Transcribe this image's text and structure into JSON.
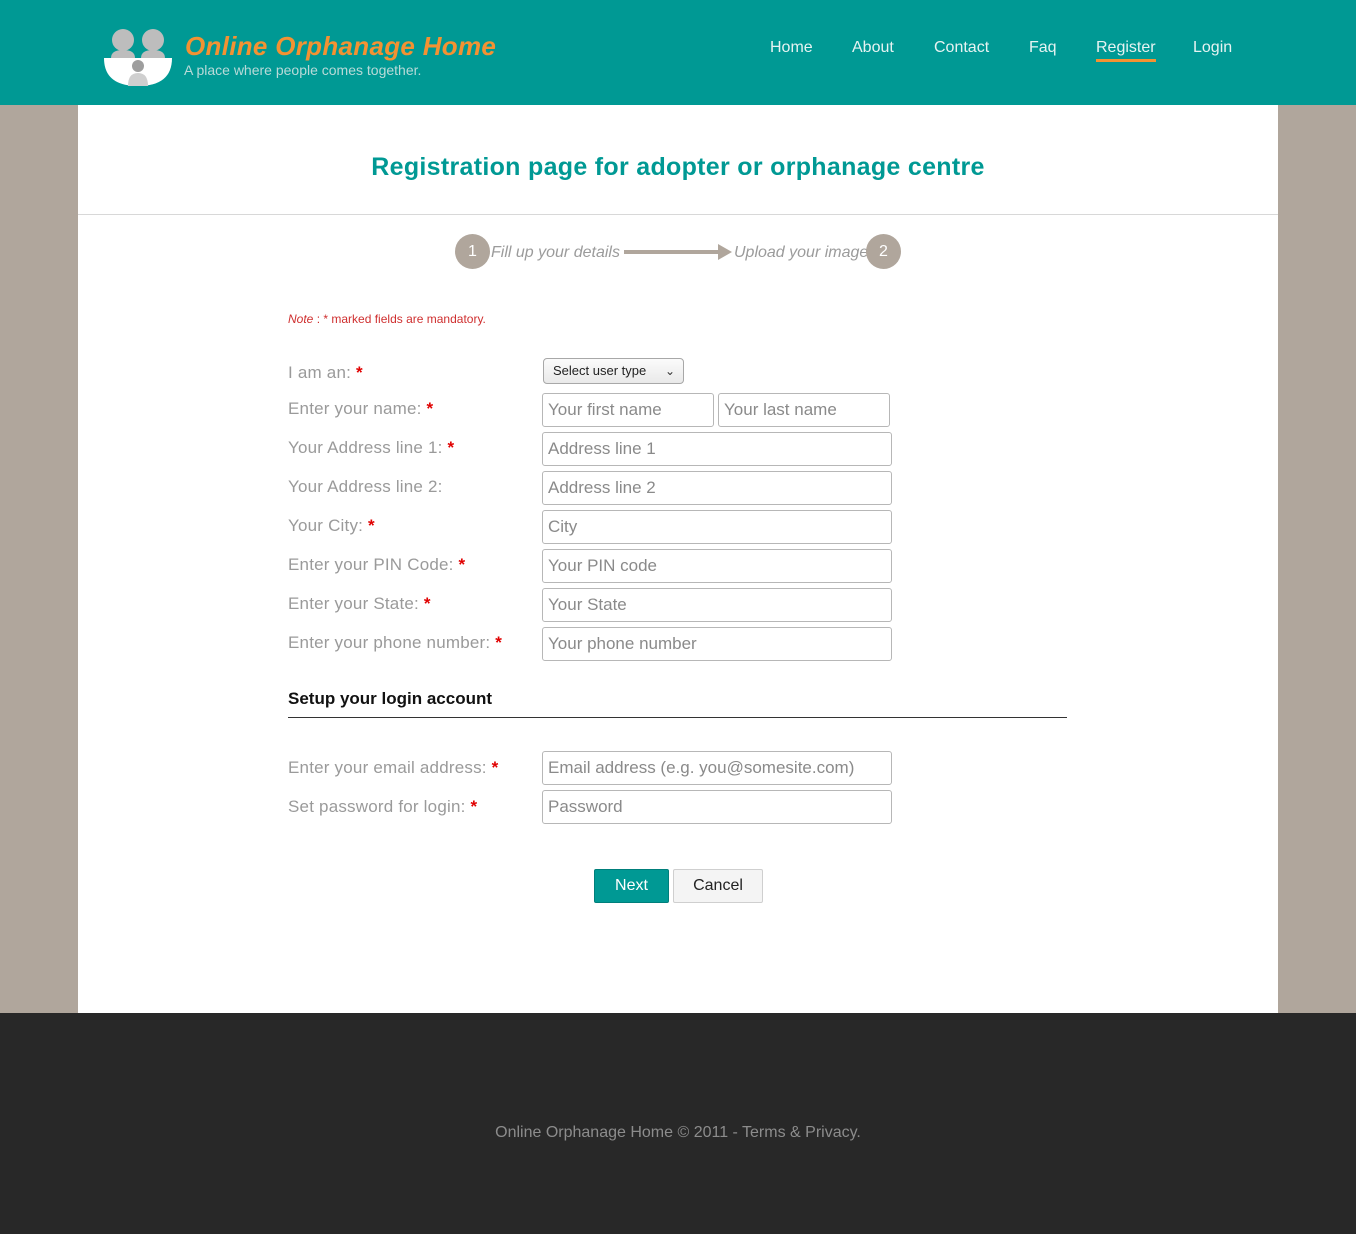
{
  "header": {
    "site_title": "Online Orphanage Home",
    "tagline": "A place where people comes together.",
    "nav": [
      {
        "label": "Home"
      },
      {
        "label": "About"
      },
      {
        "label": "Contact"
      },
      {
        "label": "Faq"
      },
      {
        "label": "Register",
        "active": true
      },
      {
        "label": "Login"
      }
    ]
  },
  "main": {
    "title": "Registration page for adopter or orphanage centre",
    "steps": [
      {
        "number": "1",
        "label": "Fill up your details"
      },
      {
        "number": "2",
        "label": "Upload your image"
      }
    ],
    "note_prefix": "Note",
    "note_text": ": * marked fields are mandatory.",
    "form": {
      "user_type": {
        "label": "I am an:",
        "selected": "Select user type"
      },
      "name": {
        "label": "Enter your name:",
        "first_placeholder": "Your first name",
        "last_placeholder": "Your last name"
      },
      "address1": {
        "label": "Your Address line 1:",
        "placeholder": "Address line 1"
      },
      "address2": {
        "label": "Your Address line 2:",
        "placeholder": "Address line 2"
      },
      "city": {
        "label": "Your City:",
        "placeholder": "City"
      },
      "pin": {
        "label": "Enter your PIN Code:",
        "placeholder": "Your PIN code"
      },
      "state": {
        "label": "Enter your State:",
        "placeholder": "Your State"
      },
      "phone": {
        "label": "Enter your phone number:",
        "placeholder": "Your phone number"
      },
      "login_section_title": "Setup your login account",
      "email": {
        "label": "Enter your email address:",
        "placeholder": "Email address (e.g. you@somesite.com)"
      },
      "password": {
        "label": "Set password for login:",
        "placeholder": "Password"
      },
      "required_mark": "*"
    },
    "buttons": {
      "next": "Next",
      "cancel": "Cancel"
    }
  },
  "footer": {
    "text": "Online Orphanage Home © 2011 - Terms & Privacy."
  },
  "colors": {
    "brand_teal": "#009994",
    "accent_orange": "#f39232",
    "background_taupe": "#b0a69c",
    "footer_dark": "#282828",
    "required_red": "#e00000"
  }
}
